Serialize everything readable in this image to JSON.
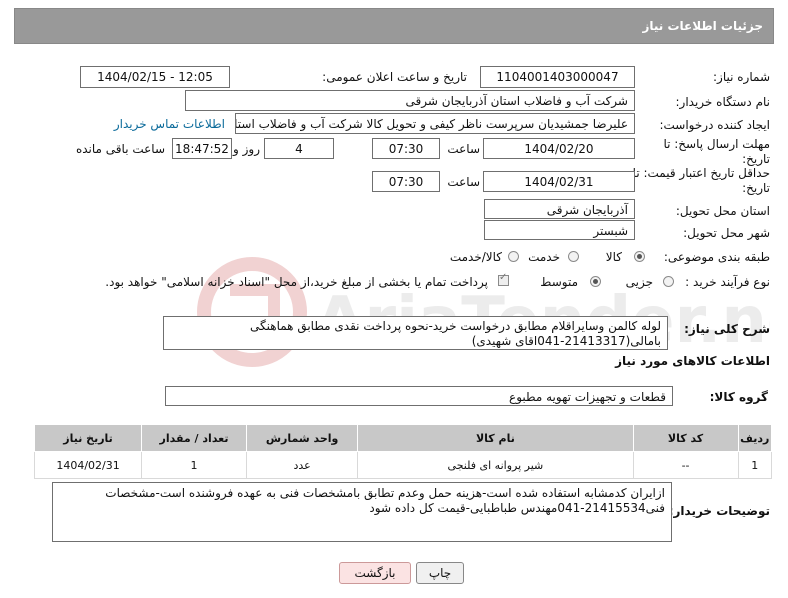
{
  "header": {
    "title": "جزئیات اطلاعات نیاز"
  },
  "fields": {
    "need_number_label": "شماره نیاز:",
    "need_number": "1104001403000047",
    "announce_label": "تاریخ و ساعت اعلان عمومی:",
    "announce_value": "1404/02/15 - 12:05",
    "buyer_org_label": "نام دستگاه خریدار:",
    "buyer_org": "شرکت آب و فاضلاب استان آذربایجان شرقی",
    "requester_label": "ایجاد کننده درخواست:",
    "requester": "علیرضا جمشیدیان سرپرست ناظر کیفی و تحویل کالا شرکت آب و فاضلاب استان",
    "contact_link": "اطلاعات تماس خریدار",
    "reply_deadline_label": "مهلت ارسال پاسخ: تا تاریخ:",
    "reply_date": "1404/02/20",
    "time_label": "ساعت",
    "reply_time": "07:30",
    "days_value": "4",
    "days_label": "روز و",
    "remaining_time": "18:47:52",
    "remaining_label": "ساعت باقی مانده",
    "price_validity_label": "حداقل تاریخ اعتبار قیمت: تا تاریخ:",
    "price_date": "1404/02/31",
    "price_time": "07:30",
    "province_label": "استان محل تحویل:",
    "province": "آذربایجان شرقی",
    "city_label": "شهر محل تحویل:",
    "city": "شبستر",
    "category_label": "طبقه بندی موضوعی:",
    "category_options": [
      "کالا",
      "خدمت",
      "کالا/خدمت"
    ],
    "process_label": "نوع فرآیند خرید :",
    "process_options": [
      "جزیی",
      "متوسط"
    ],
    "payment_note": "پرداخت تمام یا بخشی از مبلغ خرید،از محل \"اسناد خزانه اسلامی\" خواهد بود.",
    "summary_label": "شرح کلی نیاز:",
    "summary": "لوله کالمن وسایراقلام مطابق درخواست خرید-نحوه پرداخت نقدی مطابق هماهنگی بامالی(21413317-041اقای شهیدی)",
    "goods_info_title": "اطلاعات کالاهای مورد نیاز",
    "goods_group_label": "گروه کالا:",
    "goods_group": "قطعات و تجهیزات تهویه مطبوع"
  },
  "table": {
    "columns": [
      "ردیف",
      "کد کالا",
      "نام کالا",
      "واحد شمارش",
      "تعداد / مقدار",
      "تاریخ نیاز"
    ],
    "rows": [
      [
        "1",
        "--",
        "شیر پروانه ای فلنجی",
        "عدد",
        "1",
        "1404/02/31"
      ]
    ]
  },
  "buyer_notes_label": "توضیحات خریدار:",
  "buyer_notes": "ازایران کدمشابه استفاده شده است-هزینه حمل وعدم تطابق بامشخصات فنی به عهده فروشنده است-مشخصات فنی21415534-041مهندس طباطبایی-قیمت کل داده شود",
  "buttons": {
    "print": "چاپ",
    "back": "بازگشت"
  },
  "watermark": "AriaTender.neT"
}
